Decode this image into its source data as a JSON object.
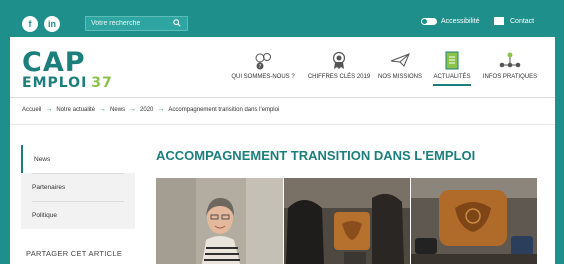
{
  "topbar": {
    "facebook": "f",
    "linkedin": "in",
    "search_placeholder": "Votre recherche",
    "accessibility_label": "Accessibilité",
    "contact_label": "Contact"
  },
  "logo": {
    "line1": "CAP",
    "line2": "EMPLOI",
    "number": "37"
  },
  "nav": [
    {
      "label": "QUI SOMMES-NOUS ?",
      "icon": "people-question-icon"
    },
    {
      "label": "CHIFFRES CLÉS 2019",
      "icon": "award-ribbon-icon"
    },
    {
      "label": "NOS MISSIONS",
      "icon": "paper-plane-icon"
    },
    {
      "label": "ACTUALITÉS",
      "icon": "document-icon",
      "active": true
    },
    {
      "label": "INFOS PRATIQUES",
      "icon": "network-nodes-icon"
    }
  ],
  "breadcrumb": [
    "Accueil",
    "Notre actualité",
    "News",
    "2020",
    "Accompagnement transition dans l'emploi"
  ],
  "sidebar": {
    "items": [
      "News",
      "Partenaires",
      "Politique"
    ],
    "share_label": "PARTAGER CET ARTICLE"
  },
  "article": {
    "title": "ACCOMPAGNEMENT TRANSITION DANS L'EMPLOI"
  },
  "colors": {
    "teal": "#1f8f8c",
    "accent": "#1c7f7c",
    "green": "#8bc34a"
  }
}
